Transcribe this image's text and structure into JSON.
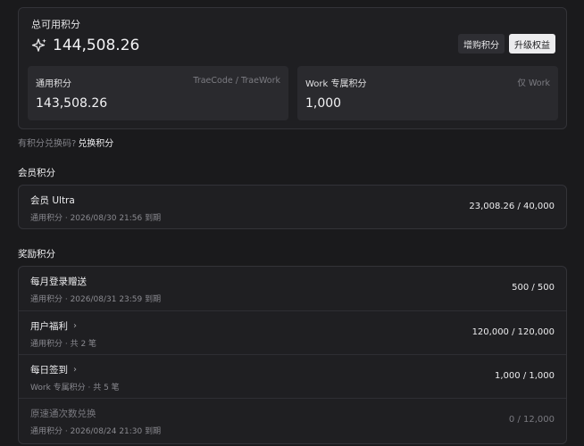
{
  "summary": {
    "title": "总可用积分",
    "total": "144,508.26",
    "buy_label": "增购积分",
    "upgrade_label": "升级权益",
    "general": {
      "label": "通用积分",
      "scope": "TraeCode / TraeWork",
      "value": "143,508.26"
    },
    "work": {
      "label": "Work 专属积分",
      "scope": "仅 Work",
      "value": "1,000"
    }
  },
  "redeem": {
    "question": "有积分兑换码?",
    "link": "兑换积分"
  },
  "member_section": {
    "title": "会员积分",
    "rows": [
      {
        "name": "会员 Ultra",
        "sub": "通用积分 · 2026/08/30 21:56 到期",
        "amount": "23,008.26 / 40,000"
      }
    ]
  },
  "reward_section": {
    "title": "奖励积分",
    "rows": [
      {
        "name": "每月登录赠送",
        "sub": "通用积分 · 2026/08/31 23:59 到期",
        "amount": "500 / 500"
      },
      {
        "name": "用户福利",
        "sub": "通用积分 · 共 2 笔",
        "amount": "120,000 / 120,000",
        "chevron": "›"
      },
      {
        "name": "每日签到",
        "sub": "Work 专属积分 · 共 5 笔",
        "amount": "1,000 / 1,000",
        "chevron": "›"
      },
      {
        "name": "原速通次数兑换",
        "sub": "通用积分 · 2026/08/24 21:30 到期",
        "amount": "0 / 12,000"
      }
    ]
  },
  "colors": {
    "background": "#1a1a1c",
    "card": "#1f1f22",
    "sub_card": "#2a2a2e",
    "accent_button": "#ececee"
  }
}
